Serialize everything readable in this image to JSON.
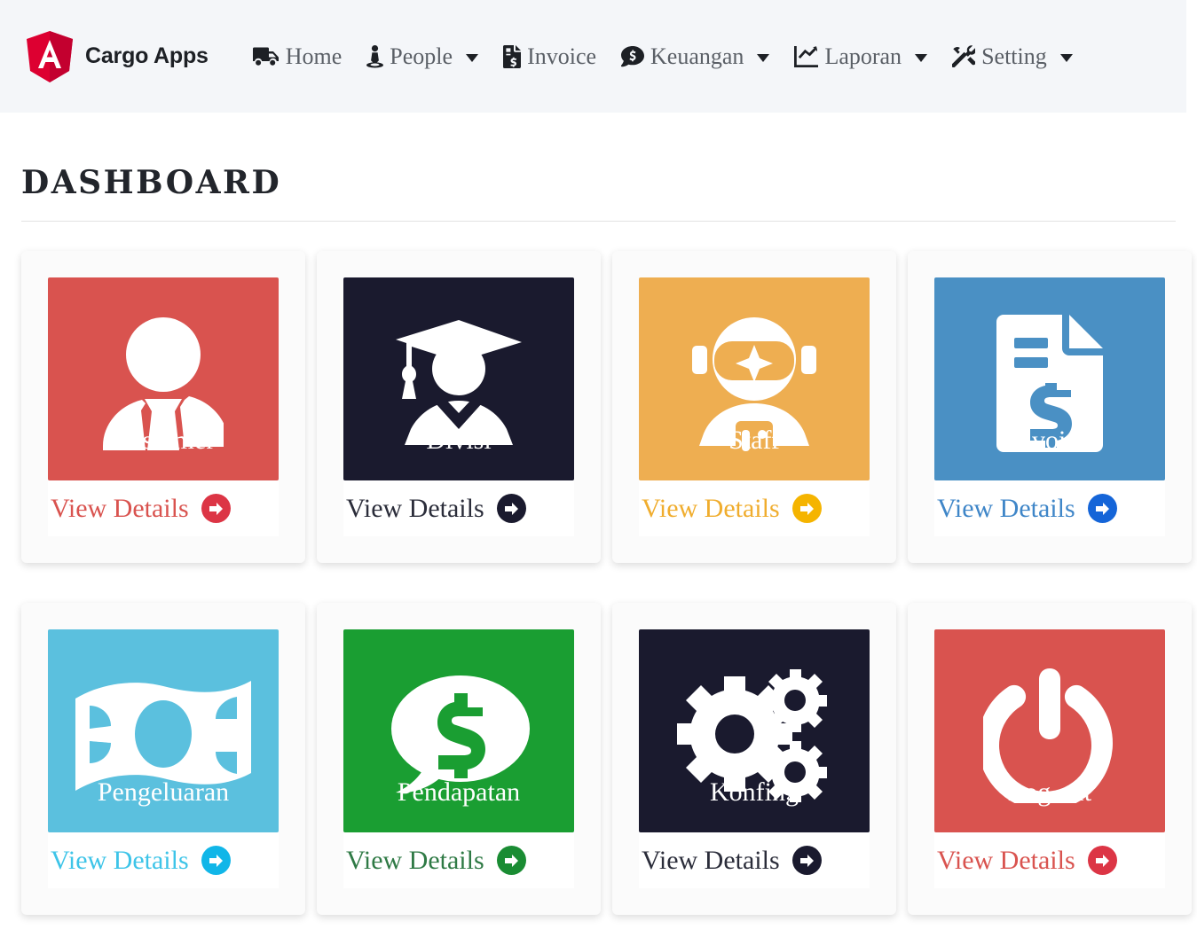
{
  "brand": {
    "logo_icon": "angular-shield-logo",
    "title": "Cargo Apps",
    "logo_color": "#dd0031"
  },
  "navbar": {
    "background": "#f4f6f9",
    "items": [
      {
        "label": "Home",
        "icon": "truck-icon",
        "has_dropdown": false
      },
      {
        "label": "People",
        "icon": "user-tie-icon",
        "has_dropdown": true
      },
      {
        "label": "Invoice",
        "icon": "file-invoice-dollar-icon",
        "has_dropdown": false
      },
      {
        "label": "Keuangan",
        "icon": "comment-dollar-icon",
        "has_dropdown": true
      },
      {
        "label": "Laporan",
        "icon": "chart-line-icon",
        "has_dropdown": true
      },
      {
        "label": "Setting",
        "icon": "tools-icon",
        "has_dropdown": true
      }
    ]
  },
  "page": {
    "title": "DASHBOARD"
  },
  "cards": [
    {
      "label": "Customer",
      "icon": "user-tie-person-icon",
      "tile_color": "#d9534f",
      "link_label": "View Details",
      "link_color": "#d9534f",
      "arrow_color": "#dc3545"
    },
    {
      "label": "Divisi",
      "icon": "graduation-cap-user-icon",
      "tile_color": "#1a1a2e",
      "link_label": "View Details",
      "link_color": "#2b2d3a",
      "arrow_color": "#1a1a2e"
    },
    {
      "label": "Staff",
      "icon": "astronaut-icon",
      "tile_color": "#eeae51",
      "link_label": "View Details",
      "link_color": "#f0ad2e",
      "arrow_color": "#f5b400"
    },
    {
      "label": "Invoice",
      "icon": "file-invoice-dollar-icon",
      "tile_color": "#4a90c4",
      "link_label": "View Details",
      "link_color": "#3f86c8",
      "arrow_color": "#1565d8"
    },
    {
      "label": "Pengeluaran",
      "icon": "money-bill-wave-icon",
      "tile_color": "#5bc0de",
      "link_label": "View Details",
      "link_color": "#3dc4e8",
      "arrow_color": "#11b6e8"
    },
    {
      "label": "Pendapatan",
      "icon": "comment-dollar-icon",
      "tile_color": "#1a9e32",
      "link_label": "View Details",
      "link_color": "#2f7a45",
      "arrow_color": "#1a8c33"
    },
    {
      "label": "Konfing",
      "icon": "cogs-icon",
      "tile_color": "#1a1a2e",
      "link_label": "View Details",
      "link_color": "#2b2d3a",
      "arrow_color": "#1a1a2e"
    },
    {
      "label": "Log out",
      "icon": "power-off-icon",
      "tile_color": "#d9534f",
      "link_label": "View Details",
      "link_color": "#d9534f",
      "arrow_color": "#dc3545"
    }
  ]
}
